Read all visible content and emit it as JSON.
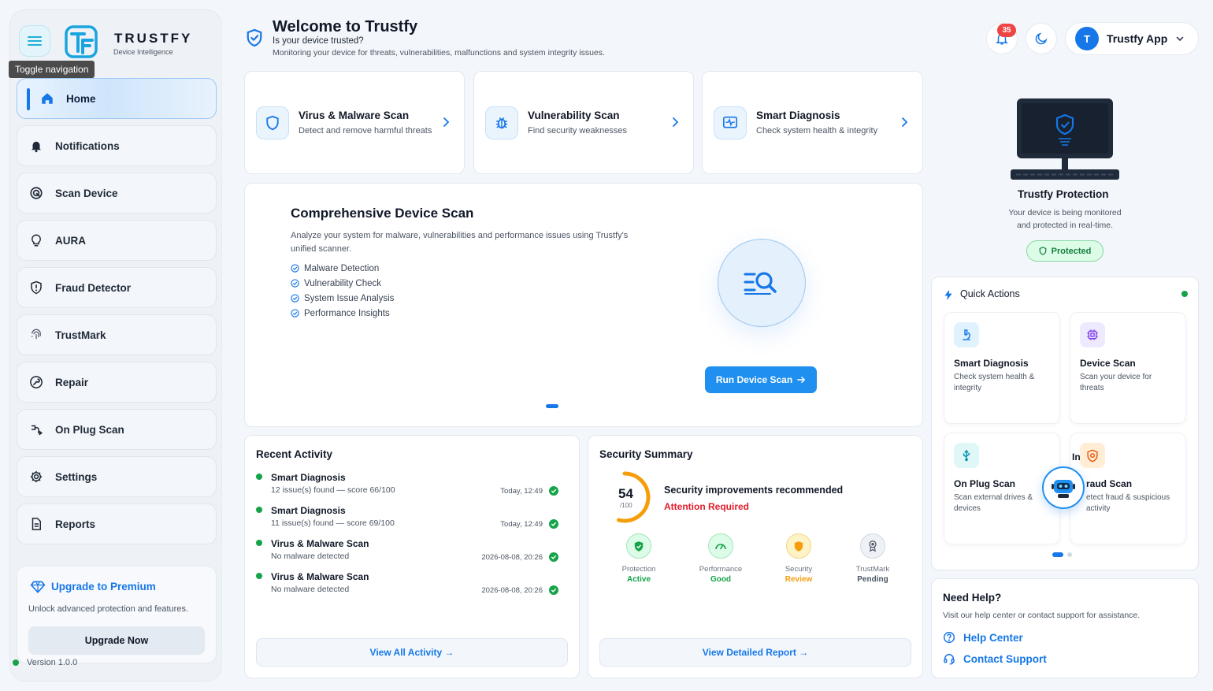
{
  "brand": {
    "name": "TRUSTFY",
    "subtitle": "Device Intelligence",
    "tooltip": "Toggle navigation"
  },
  "sidebar": {
    "items": [
      {
        "label": "Home",
        "icon": "home-icon",
        "active": true
      },
      {
        "label": "Notifications",
        "icon": "bell-icon"
      },
      {
        "label": "Scan Device",
        "icon": "target-icon"
      },
      {
        "label": "AURA",
        "icon": "bulb-icon"
      },
      {
        "label": "Fraud Detector",
        "icon": "shield-alert-icon"
      },
      {
        "label": "TrustMark",
        "icon": "fingerprint-icon"
      },
      {
        "label": "Repair",
        "icon": "wrench-icon"
      },
      {
        "label": "On Plug Scan",
        "icon": "plug-icon"
      },
      {
        "label": "Settings",
        "icon": "gear-icon"
      },
      {
        "label": "Reports",
        "icon": "document-icon"
      }
    ],
    "premium": {
      "title": "Upgrade to Premium",
      "desc": "Unlock advanced protection and features.",
      "button": "Upgrade Now"
    },
    "version": "Version 1.0.0"
  },
  "header": {
    "title": "Welcome to Trustfy",
    "question": "Is your device trusted?",
    "subtitle": "Monitoring your device for threats, vulnerabilities, malfunctions and system integrity issues.",
    "notif_count": "35",
    "user_initial": "T",
    "user_name": "Trustfy App"
  },
  "scans": [
    {
      "title": "Virus & Malware Scan",
      "desc": "Detect and remove harmful threats"
    },
    {
      "title": "Vulnerability Scan",
      "desc": "Find security weaknesses"
    },
    {
      "title": "Smart Diagnosis",
      "desc": "Check system health & integrity"
    }
  ],
  "comprehensive": {
    "title": "Comprehensive Device Scan",
    "desc": "Analyze your system for malware, vulnerabilities and performance issues using Trustfy's unified scanner.",
    "features": [
      "Malware Detection",
      "Vulnerability Check",
      "System Issue Analysis",
      "Performance Insights"
    ],
    "button": "Run Device Scan"
  },
  "activity": {
    "title": "Recent Activity",
    "items": [
      {
        "title": "Smart Diagnosis",
        "desc": "12 issue(s) found — score 66/100",
        "time": "Today, 12:49"
      },
      {
        "title": "Smart Diagnosis",
        "desc": "11 issue(s) found — score 69/100",
        "time": "Today, 12:49"
      },
      {
        "title": "Virus & Malware Scan",
        "desc": "No malware detected",
        "time": "2026-08-08, 20:26"
      },
      {
        "title": "Virus & Malware Scan",
        "desc": "No malware detected",
        "time": "2026-08-08, 20:26"
      }
    ],
    "button": "View All Activity →"
  },
  "summary": {
    "title": "Security Summary",
    "score": "54",
    "score_max": "/100",
    "score_fraction": 0.54,
    "headline": "Security improvements recommended",
    "alert": "Attention Required",
    "metrics": [
      {
        "label": "Protection",
        "value": "Active",
        "color": "#15a34a"
      },
      {
        "label": "Performance",
        "value": "Good",
        "color": "#15a34a"
      },
      {
        "label": "Security",
        "value": "Review",
        "color": "#f59e0b"
      },
      {
        "label": "TrustMark",
        "value": "Pending",
        "color": "#4b5563"
      }
    ],
    "button": "View Detailed Report →"
  },
  "protection": {
    "title": "Trustfy Protection",
    "desc": "Your device is being monitored and protected in real-time.",
    "badge": "Protected"
  },
  "quick_actions": {
    "title": "Quick Actions",
    "items": [
      {
        "title": "Smart Diagnosis",
        "desc": "Check system health & integrity",
        "icon": "microscope-icon"
      },
      {
        "title": "Device Scan",
        "desc": "Scan your device for threats",
        "icon": "chip-icon"
      },
      {
        "title": "On Plug Scan",
        "desc": "Scan external drives & devices",
        "icon": "usb-icon"
      },
      {
        "title": "Fraud Scan",
        "desc": "Detect fraud & suspicious activity",
        "icon": "shield-fraud-icon",
        "visible_title": "Int",
        "visible_title_rest": "raud Scan",
        "visible_desc": "etect fraud & suspicious activity"
      }
    ]
  },
  "help": {
    "title": "Need Help?",
    "desc": "Visit our help center or contact support for assistance.",
    "help_center": "Help Center",
    "contact": "Contact Support"
  },
  "colors": {
    "accent": "#1677e8",
    "success": "#16a34a",
    "danger": "#e11d2a",
    "warning": "#f59e0b",
    "gauge": "#f59e0b"
  }
}
